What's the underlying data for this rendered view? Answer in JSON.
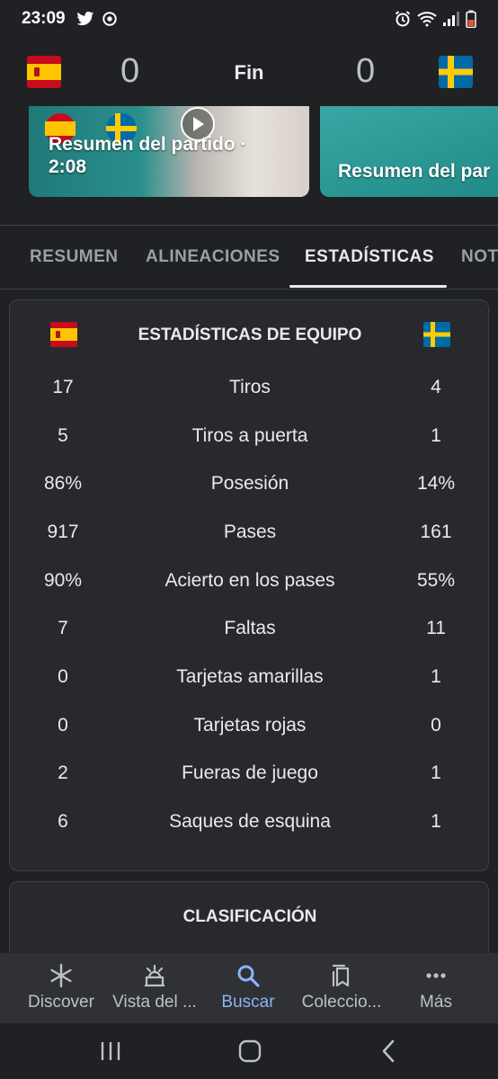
{
  "status_bar": {
    "time": "23:09",
    "left_icons": [
      "twitter-icon",
      "sync-icon"
    ],
    "right_icons": [
      "alarm-icon",
      "wifi-icon",
      "signal-icon",
      "battery-icon"
    ]
  },
  "match": {
    "home_team_flag": "spain-flag",
    "away_team_flag": "sweden-flag",
    "home_score": "0",
    "away_score": "0",
    "status": "Fin"
  },
  "videos": [
    {
      "title": "Resumen del partido · 2:08"
    },
    {
      "title": "Resumen del par"
    }
  ],
  "tabs": [
    {
      "label": "RESUMEN",
      "active": false
    },
    {
      "label": "ALINEACIONES",
      "active": false
    },
    {
      "label": "ESTADÍSTICAS",
      "active": true
    },
    {
      "label": "NOT",
      "active": false
    }
  ],
  "team_stats": {
    "title": "ESTADÍSTICAS DE EQUIPO",
    "rows": [
      {
        "home": "17",
        "label": "Tiros",
        "away": "4"
      },
      {
        "home": "5",
        "label": "Tiros a puerta",
        "away": "1"
      },
      {
        "home": "86%",
        "label": "Posesión",
        "away": "14%"
      },
      {
        "home": "917",
        "label": "Pases",
        "away": "161"
      },
      {
        "home": "90%",
        "label": "Acierto en los pases",
        "away": "55%"
      },
      {
        "home": "7",
        "label": "Faltas",
        "away": "11"
      },
      {
        "home": "0",
        "label": "Tarjetas amarillas",
        "away": "1"
      },
      {
        "home": "0",
        "label": "Tarjetas rojas",
        "away": "0"
      },
      {
        "home": "2",
        "label": "Fueras de juego",
        "away": "1"
      },
      {
        "home": "6",
        "label": "Saques de esquina",
        "away": "1"
      }
    ]
  },
  "standings": {
    "title": "CLASIFICACIÓN"
  },
  "bottom_nav": [
    {
      "label": "Discover",
      "icon": "asterisk-icon",
      "active": false
    },
    {
      "label": "Vista del ...",
      "icon": "sunrise-icon",
      "active": false
    },
    {
      "label": "Buscar",
      "icon": "search-icon",
      "active": true
    },
    {
      "label": "Coleccio...",
      "icon": "collections-icon",
      "active": false
    },
    {
      "label": "Más",
      "icon": "more-icon",
      "active": false
    }
  ],
  "colors": {
    "background": "#202124",
    "card": "#28292c",
    "accent": "#8ab4f8",
    "text": "#e8eaed",
    "muted": "#9aa0a6"
  }
}
